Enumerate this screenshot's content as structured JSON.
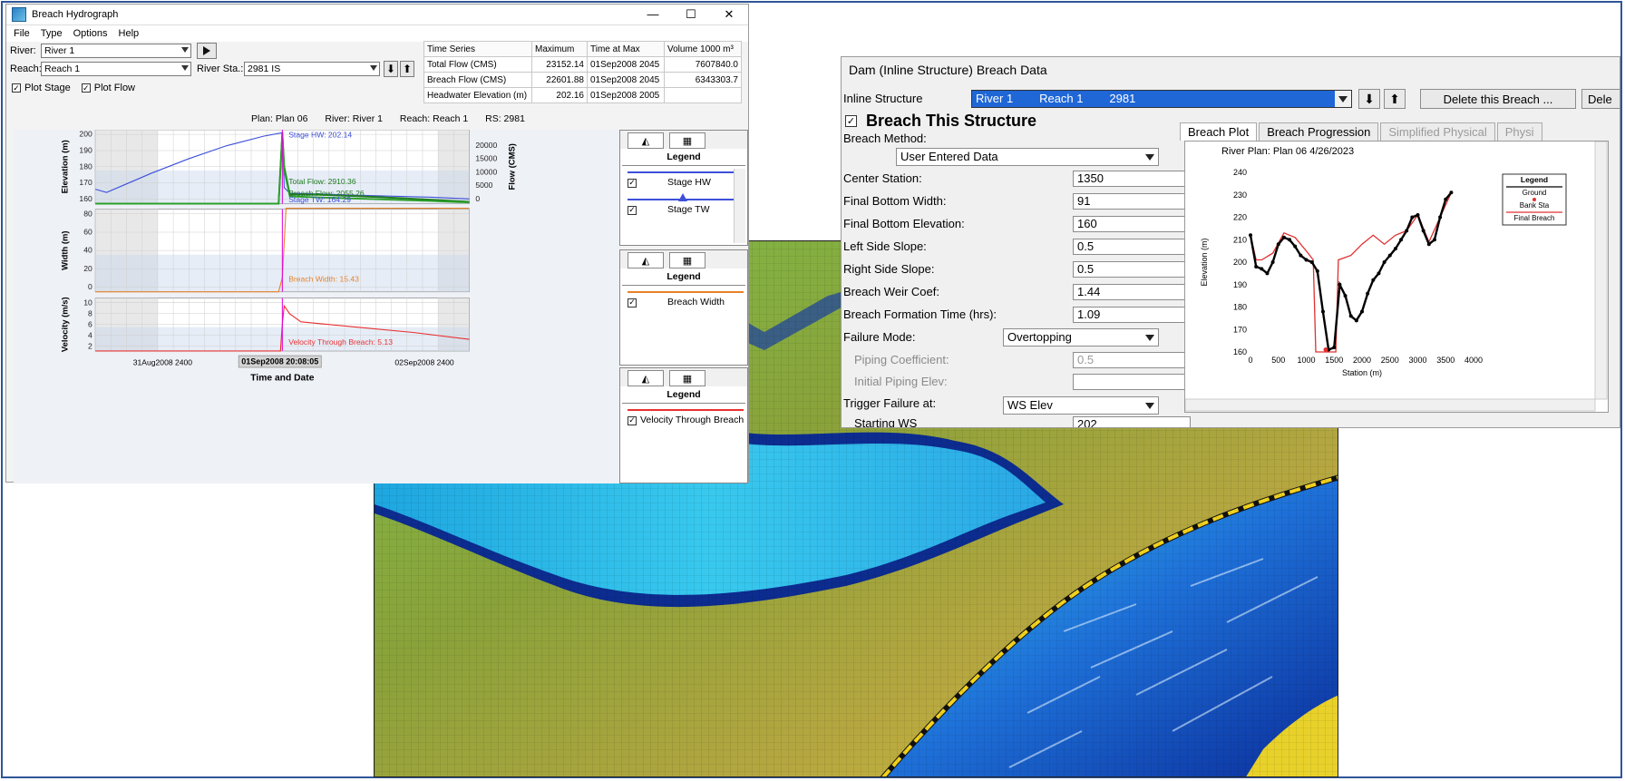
{
  "hydrograph": {
    "title": "Breach Hydrograph",
    "window_controls": [
      "—",
      "☐",
      "✕"
    ],
    "menu": [
      "File",
      "Type",
      "Options",
      "Help"
    ],
    "river_label": "River:",
    "river_value": "River 1",
    "reach_label": "Reach:",
    "reach_value": "Reach 1",
    "river_sta_label": "River Sta.:",
    "river_sta_value": "2981 IS",
    "plot_stage_label": "Plot Stage",
    "plot_flow_label": "Plot Flow",
    "table": {
      "headers": [
        "Time Series",
        "Maximum",
        "Time at Max",
        "Volume 1000 m³"
      ],
      "rows": [
        [
          "Total Flow (CMS)",
          "23152.14",
          "01Sep2008 2045",
          "7607840.0"
        ],
        [
          "Breach Flow (CMS)",
          "22601.88",
          "01Sep2008 2045",
          "6343303.7"
        ],
        [
          "Headwater Elevation (m)",
          "202.16",
          "01Sep2008 2005",
          ""
        ]
      ]
    },
    "plot_info": {
      "plan": "Plan: Plan 06",
      "river": "River: River 1",
      "reach": "Reach: Reach 1",
      "rs": "RS: 2981"
    },
    "legends": [
      {
        "title": "Legend",
        "items": [
          "Stage HW",
          "Stage TW"
        ]
      },
      {
        "title": "Legend",
        "items": [
          "Breach Width"
        ]
      },
      {
        "title": "Legend",
        "items": [
          "Velocity Through Breach"
        ]
      }
    ]
  },
  "chart_data": [
    {
      "type": "line",
      "panel": "stage_flow",
      "ylabel": "Elevation (m)",
      "y2label": "Flow (CMS)",
      "ylim": [
        158,
        204
      ],
      "y2lim": [
        0,
        24000
      ],
      "yticks": [
        "200",
        "190",
        "180",
        "170",
        "160"
      ],
      "y2ticks": [
        "20000",
        "15000",
        "10000",
        "5000",
        "0"
      ],
      "annotations": [
        "Stage HW: 202.14",
        "Total Flow: 2910.36",
        "Breach Flow: 2055.26",
        "Stage TW: 164.29"
      ],
      "series": [
        {
          "name": "Stage HW",
          "color": "#3d50d8",
          "x": [
            0,
            0.03,
            0.08,
            0.15,
            0.25,
            0.35,
            0.45,
            0.5,
            0.505,
            0.52,
            0.6,
            0.75,
            0.9,
            1.0
          ],
          "y": [
            167,
            165,
            170,
            177,
            186,
            194,
            200,
            202.14,
            168,
            164.5,
            164,
            163,
            162,
            161
          ]
        },
        {
          "name": "Total Flow",
          "axis": "y2",
          "color": "#1f7a1f",
          "x": [
            0,
            0.49,
            0.5,
            0.505,
            0.52,
            0.6,
            0.75,
            0.9,
            1.0
          ],
          "y": [
            0,
            0,
            23152,
            12000,
            3000,
            2910,
            2200,
            1300,
            600
          ]
        },
        {
          "name": "Breach Flow",
          "axis": "y2",
          "color": "#2aa02a",
          "x": [
            0,
            0.49,
            0.5,
            0.505,
            0.52,
            0.6,
            0.75,
            0.9,
            1.0
          ],
          "y": [
            0,
            0,
            22602,
            11000,
            2400,
            2055,
            1500,
            900,
            400
          ]
        }
      ]
    },
    {
      "type": "line",
      "panel": "width",
      "ylabel": "Width (m)",
      "ylim": [
        0,
        90
      ],
      "yticks": [
        "80",
        "60",
        "40",
        "20",
        "0"
      ],
      "annotations": [
        "Breach Width: 15.43"
      ],
      "series": [
        {
          "name": "Breach Width",
          "color": "#e8822a",
          "x": [
            0,
            0.49,
            0.5,
            0.51,
            1.0
          ],
          "y": [
            0,
            0,
            15.43,
            91,
            91
          ]
        }
      ]
    },
    {
      "type": "line",
      "panel": "velocity",
      "ylabel": "Velocity (m/s)",
      "ylim": [
        0,
        10
      ],
      "yticks": [
        "10",
        "8",
        "6",
        "4",
        "2"
      ],
      "annotations": [
        "Velocity Through Breach: 5.13"
      ],
      "series": [
        {
          "name": "Velocity Through Breach",
          "color": "#e83030",
          "x": [
            0,
            0.495,
            0.5,
            0.505,
            0.52,
            0.55,
            0.7,
            0.85,
            1.0
          ],
          "y": [
            0,
            0,
            5.13,
            8.5,
            7,
            5.5,
            4.5,
            3.5,
            2.2
          ]
        }
      ]
    },
    {
      "type": "line",
      "panel": "breach_plot",
      "title": "River      Plan: Plan 06      4/26/2023",
      "xlabel": "Station (m)",
      "ylabel": "Elevation (m)",
      "xlim": [
        0,
        4000
      ],
      "ylim": [
        160,
        240
      ],
      "xticks": [
        "0",
        "500",
        "1000",
        "1500",
        "2000",
        "2500",
        "3000",
        "3500",
        "4000"
      ],
      "yticks": [
        "240",
        "230",
        "220",
        "210",
        "200",
        "190",
        "180",
        "170",
        "160"
      ],
      "legend_title": "Legend",
      "legend_items": [
        "Ground",
        "Bank Sta",
        "Final Breach"
      ],
      "series": [
        {
          "name": "Ground",
          "color": "#000000",
          "x": [
            0,
            100,
            200,
            300,
            400,
            500,
            600,
            700,
            800,
            900,
            1000,
            1100,
            1200,
            1300,
            1400,
            1500,
            1600,
            1700,
            1800,
            1900,
            2000,
            2100,
            2200,
            2300,
            2400,
            2500,
            2600,
            2700,
            2800,
            2900,
            3000,
            3100,
            3200,
            3300,
            3400,
            3500,
            3600
          ],
          "y": [
            212,
            198,
            197,
            195,
            200,
            208,
            211,
            210,
            207,
            203,
            201,
            200,
            196,
            178,
            161,
            162,
            190,
            185,
            176,
            174,
            178,
            186,
            192,
            195,
            200,
            203,
            206,
            210,
            214,
            220,
            221,
            214,
            208,
            210,
            220,
            228,
            231
          ]
        },
        {
          "name": "Final Breach",
          "color": "#e03030",
          "x": [
            0,
            100,
            200,
            400,
            600,
            800,
            1000,
            1125,
            1170,
            1530,
            1575,
            1800,
            2000,
            2200,
            2400,
            2600,
            2800,
            3000,
            3200,
            3400,
            3600
          ],
          "y": [
            212,
            201,
            201,
            204,
            213,
            211,
            205,
            201,
            160,
            160,
            201,
            203,
            208,
            212,
            208,
            212,
            214,
            221,
            209,
            220,
            231
          ]
        }
      ]
    }
  ],
  "time_axis": {
    "label": "Time and Date",
    "ticks": [
      "31Aug2008 2400",
      "01Sep2008 2400",
      "02Sep2008 2400"
    ],
    "cursor_label": "01Sep2008 20:08:05"
  },
  "breach": {
    "title": "Dam (Inline Structure) Breach Data",
    "inline_structure_label": "Inline Structure",
    "inline_structure_value": "River 1        Reach 1        2981",
    "delete_button": "Delete this Breach ...",
    "delete2_button": "Dele",
    "breach_this_label": "Breach This Structure",
    "method_label": "Breach Method:",
    "method_value": "User Entered Data",
    "fields": [
      {
        "label": "Center Station:",
        "value": "1350"
      },
      {
        "label": "Final Bottom Width:",
        "value": "91"
      },
      {
        "label": "Final Bottom Elevation:",
        "value": "160"
      },
      {
        "label": "Left Side Slope:",
        "value": "0.5"
      },
      {
        "label": "Right Side Slope:",
        "value": "0.5"
      },
      {
        "label": "Breach Weir Coef:",
        "value": "1.44"
      },
      {
        "label": "Breach Formation Time (hrs):",
        "value": "1.09"
      }
    ],
    "failure_mode_label": "Failure Mode:",
    "failure_mode_value": "Overtopping",
    "piping_coef_label": "Piping Coefficient:",
    "piping_coef_value": "0.5",
    "initial_piping_label": "Initial Piping Elev:",
    "initial_piping_value": "",
    "trigger_label": "Trigger Failure at:",
    "trigger_value": "WS Elev",
    "starting_ws_label": "Starting WS",
    "starting_ws_value": "202",
    "tabs": [
      "Breach Plot",
      "Breach Progression",
      "Simplified Physical",
      "Physi"
    ]
  },
  "colors": {
    "accent": "#3d50d8",
    "selection": "#1f66d6",
    "frame": "#2f5597",
    "water_deep": "#0a2a8a",
    "water": "#27c3ea",
    "terrain_high": "#b7a24a",
    "terrain_low": "#7fc63a",
    "levee": "#f2d21c"
  }
}
